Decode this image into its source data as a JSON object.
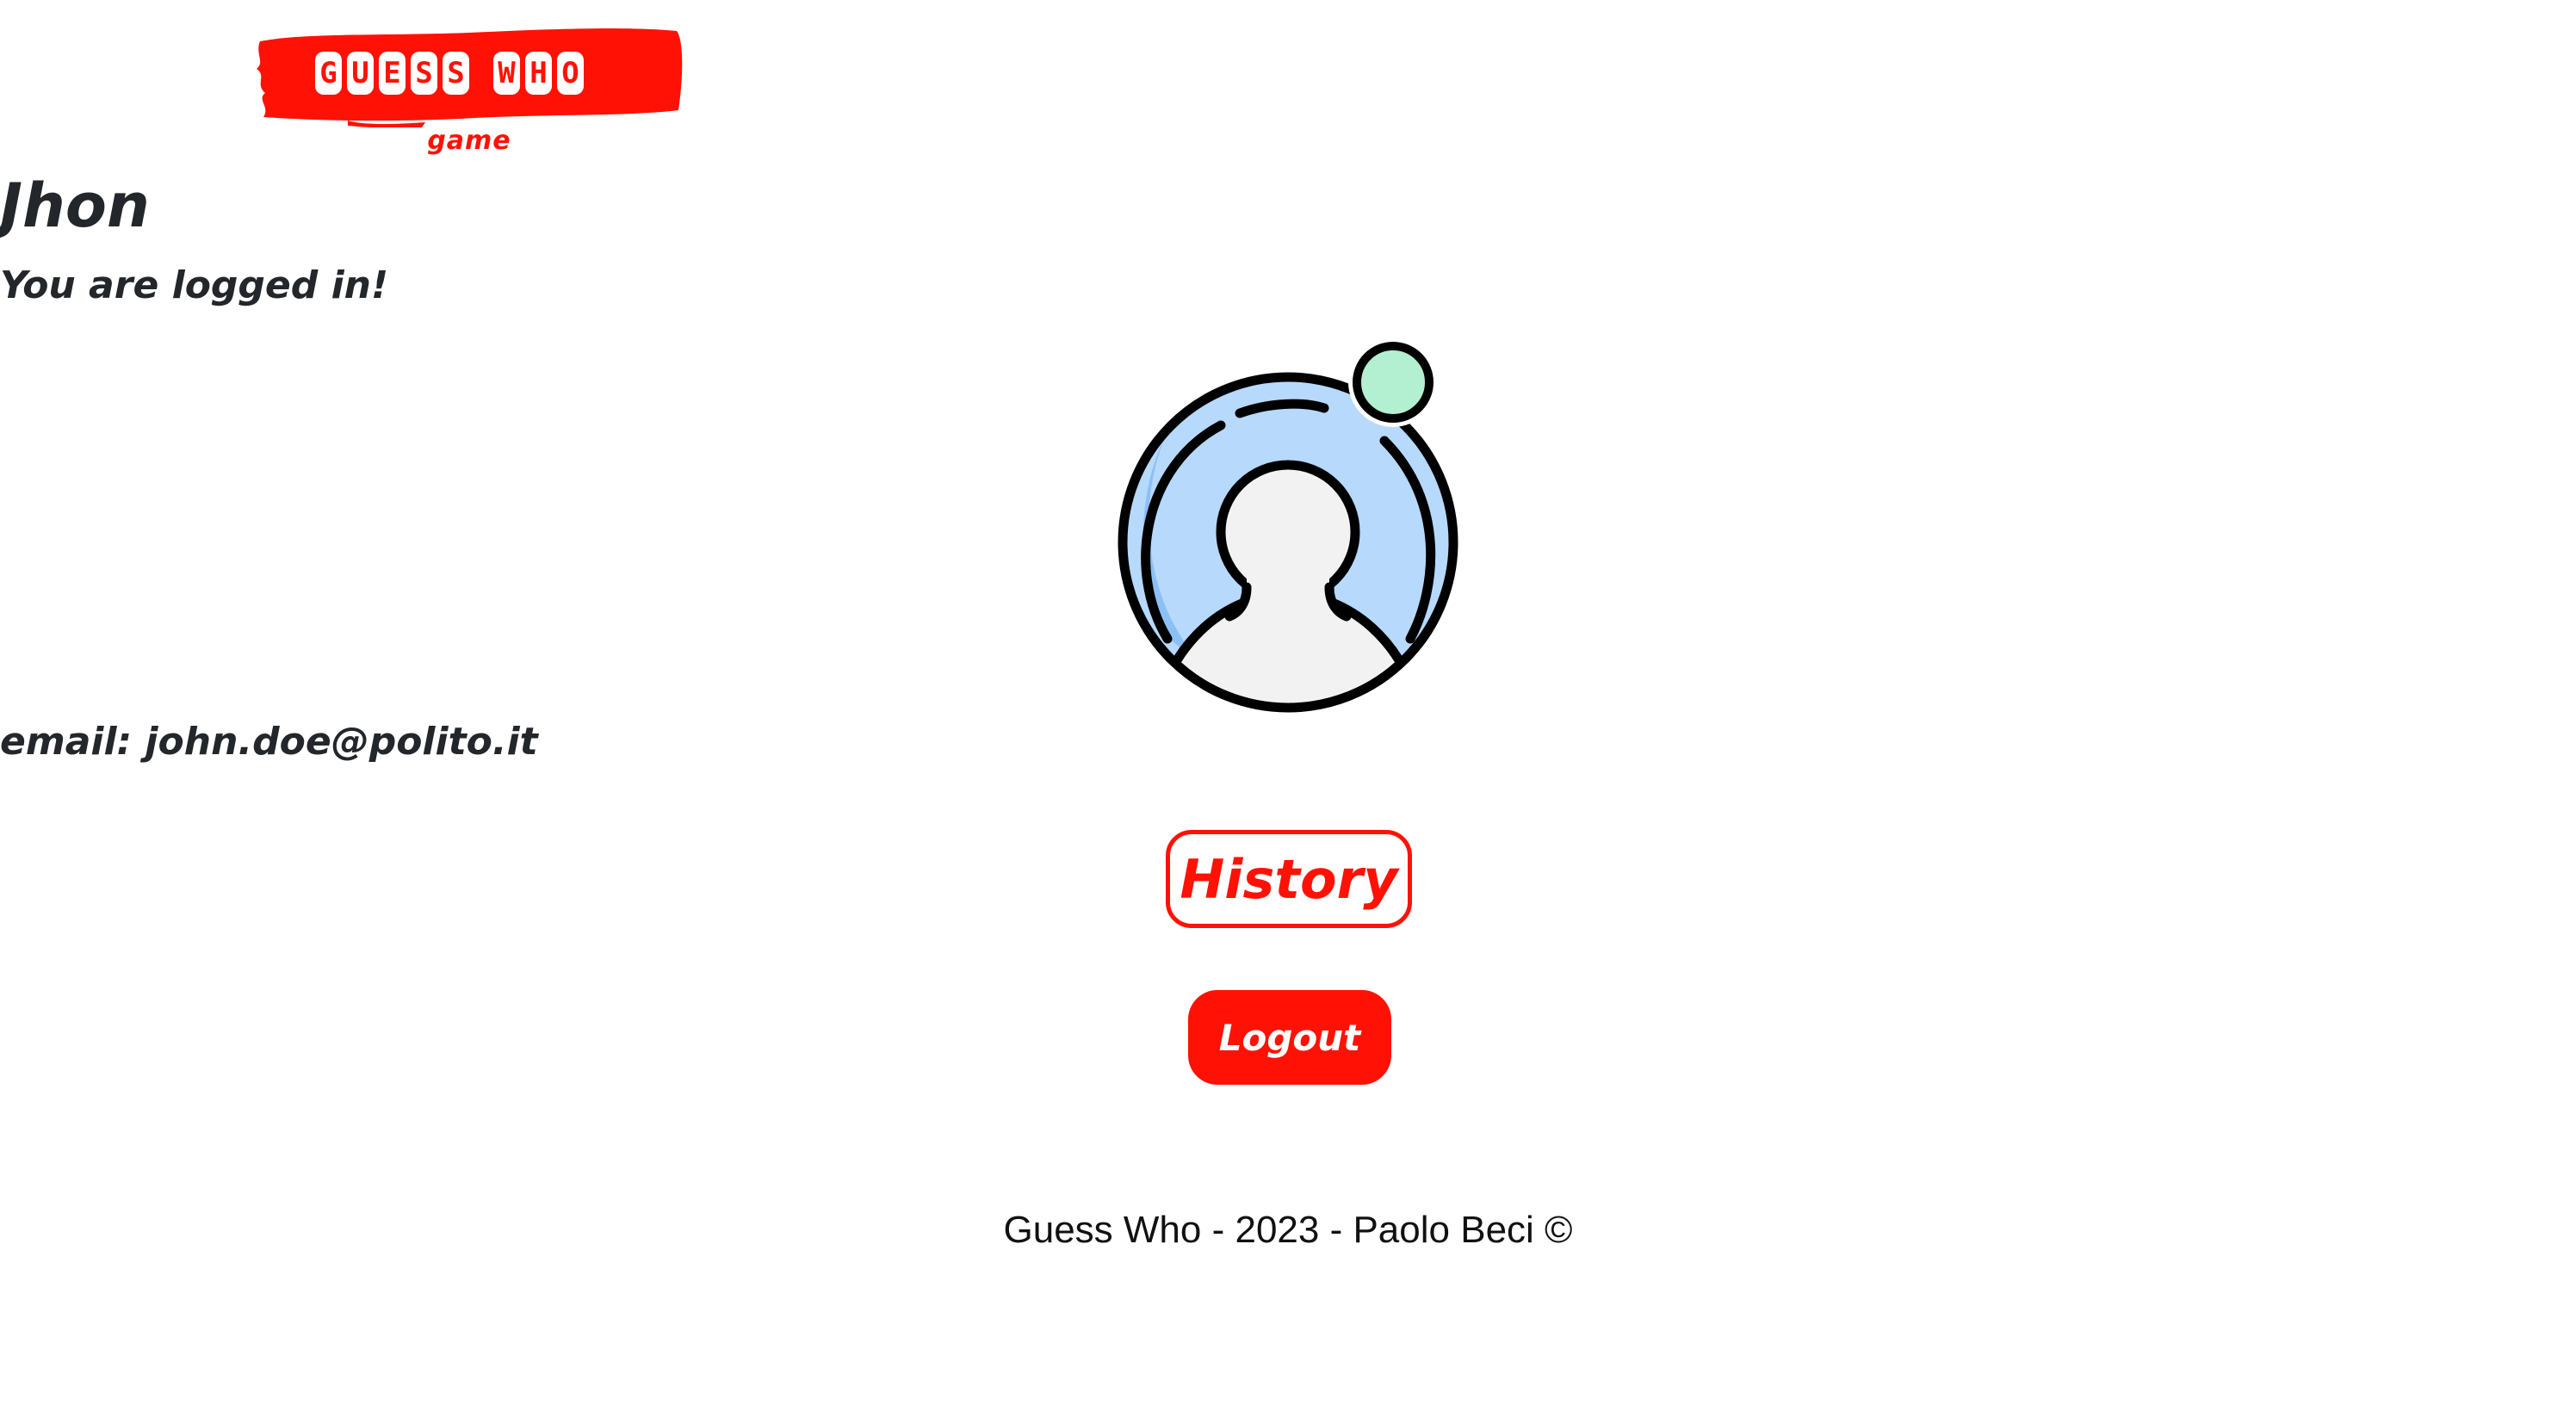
{
  "logo": {
    "letters": [
      "G",
      "U",
      "E",
      "S",
      "S",
      "W",
      "H",
      "O"
    ],
    "subtitle": "game"
  },
  "profile": {
    "name": "Jhon",
    "status": "You are logged in!",
    "email_label": "email:",
    "email": "john.doe@polito.it",
    "avatar_icon": "user-avatar-icon",
    "online_dot_color": "#b3f0d2"
  },
  "actions": {
    "history_label": "History",
    "logout_label": "Logout"
  },
  "footer": {
    "text": "Guess Who - 2023 - Paolo Beci ©"
  },
  "colors": {
    "accent": "#ff1205",
    "text": "#23262a",
    "avatar_ring": "#b7d9fb"
  }
}
